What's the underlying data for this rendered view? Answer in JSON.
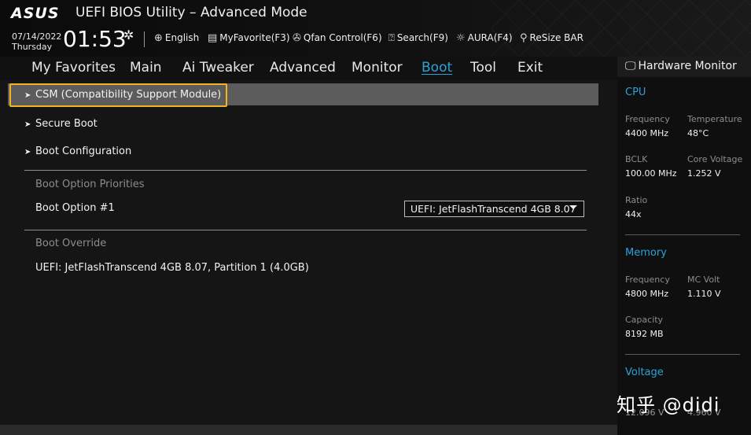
{
  "header": {
    "logo": "ASUS",
    "title": "UEFI BIOS Utility – Advanced Mode",
    "date": "07/14/2022",
    "day": "Thursday",
    "time": "01:53",
    "tools": [
      {
        "icon": "globe-icon",
        "label": "English"
      },
      {
        "icon": "myfavorite-icon",
        "label": "MyFavorite(F3)"
      },
      {
        "icon": "fan-icon",
        "label": "Qfan Control(F6)"
      },
      {
        "icon": "search-icon",
        "label": "Search(F9)"
      },
      {
        "icon": "aura-icon",
        "label": "AURA(F4)"
      },
      {
        "icon": "resize-bar-icon",
        "label": "ReSize BAR"
      }
    ]
  },
  "menu": {
    "items": [
      "My Favorites",
      "Main",
      "Ai Tweaker",
      "Advanced",
      "Monitor",
      "Boot",
      "Tool",
      "Exit"
    ],
    "active": "Boot"
  },
  "main": {
    "entries": [
      "CSM (Compatibility Support Module)",
      "Secure Boot",
      "Boot Configuration"
    ],
    "priorities_header": "Boot Option Priorities",
    "boot_option_label": "Boot Option #1",
    "boot_option_value": "UEFI: JetFlashTranscend 4GB 8.07",
    "override_header": "Boot Override",
    "override_item": "UEFI: JetFlashTranscend 4GB 8.07, Partition 1 (4.0GB)"
  },
  "hw_monitor": {
    "title": "Hardware Monitor",
    "cpu": {
      "header": "CPU",
      "frequency_label": "Frequency",
      "frequency": "4400 MHz",
      "temperature_label": "Temperature",
      "temperature": "48°C",
      "bclk_label": "BCLK",
      "bclk": "100.00 MHz",
      "core_voltage_label": "Core Voltage",
      "core_voltage": "1.252 V",
      "ratio_label": "Ratio",
      "ratio": "44x"
    },
    "memory": {
      "header": "Memory",
      "frequency_label": "Frequency",
      "frequency": "4800 MHz",
      "mc_volt_label": "MC Volt",
      "mc_volt": "1.110 V",
      "capacity_label": "Capacity",
      "capacity": "8192 MB"
    },
    "voltage": {
      "header": "Voltage",
      "v12": "12.096 V",
      "v5": "4.960 V"
    }
  },
  "watermark": "知乎 @didi",
  "colors": {
    "accent": "#2aa3d8",
    "focus": "#f2b51d",
    "highlight": "#5c5c5c"
  }
}
